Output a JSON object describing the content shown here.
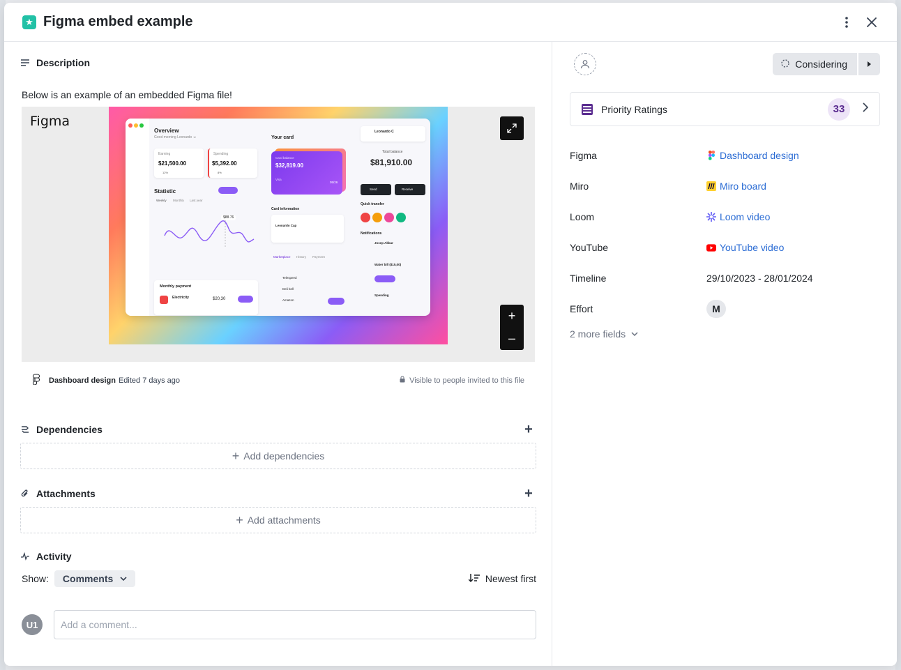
{
  "modal": {
    "title": "Figma embed example",
    "more_icon": "more-vertical-icon",
    "close_icon": "close-icon"
  },
  "description": {
    "heading": "Description",
    "text": "Below is an example of an embedded Figma file!"
  },
  "embed": {
    "brand": "Figma",
    "file_name": "Dashboard design",
    "edited": "Edited 7 days ago",
    "visibility": "Visible to people invited to this file",
    "zoom_in": "+",
    "zoom_out": "–",
    "preview": {
      "overview": "Overview",
      "good_morning": "Good morning Leonardo ☺",
      "earning_label": "Earning",
      "earning_value": "$21,500.00",
      "earning_pct": "12%",
      "spending_label": "Spending",
      "spending_value": "$5,392.00",
      "spending_pct": "8%",
      "statistic": "Statistic",
      "weekly": "Weekly",
      "monthly": "Monthly",
      "last_year": "Last year",
      "tooltip": "$88.76",
      "monthly_payment": "Monthly payment",
      "electricity": "Electricity",
      "electricity_value": "$20,30",
      "your_card": "Your card",
      "card_balance_label": "Card balance",
      "card_balance": "$32,819.00",
      "card_visa": "Visa",
      "card_exp": "05/26",
      "card_info": "Card information",
      "cardholder_name": "Leonardo Cap",
      "card_tab_marketplace": "Marketplace",
      "card_tab_history": "History",
      "card_tab_payment": "Payment",
      "market_items": [
        "Telespeed",
        "Deli bell",
        "Amazon"
      ],
      "user_name": "Leonardo C",
      "total_balance_label": "Total balance",
      "total_balance": "$81,910.00",
      "send": "Send",
      "receive": "Receive",
      "quick_transfer": "Quick transfer",
      "notifications": "Notifications",
      "notif_items": [
        "Josep Akbar",
        "Water bill ($15,00)",
        "Spending"
      ]
    }
  },
  "dependencies": {
    "heading": "Dependencies",
    "add_label": "Add dependencies"
  },
  "attachments": {
    "heading": "Attachments",
    "add_label": "Add attachments"
  },
  "activity": {
    "heading": "Activity",
    "show_label": "Show:",
    "show_value": "Comments",
    "sort_label": "Newest first",
    "avatar": "U1",
    "comment_placeholder": "Add a comment..."
  },
  "sidebar": {
    "status": "Considering",
    "priority_label": "Priority Ratings",
    "priority_score": "33",
    "fields": [
      {
        "name": "Figma",
        "value": "Dashboard design",
        "icon": "figma-icon",
        "link": true
      },
      {
        "name": "Miro",
        "value": "Miro board",
        "icon": "miro-icon",
        "link": true
      },
      {
        "name": "Loom",
        "value": "Loom video",
        "icon": "loom-icon",
        "link": true
      },
      {
        "name": "YouTube",
        "value": "YouTube video",
        "icon": "youtube-icon",
        "link": true
      },
      {
        "name": "Timeline",
        "value": "29/10/2023 - 28/01/2024",
        "link": false
      },
      {
        "name": "Effort",
        "value": "M",
        "link": false
      }
    ],
    "more_fields": "2 more fields"
  },
  "colors": {
    "accent_link": "#2b6cd4",
    "priority": "#5b2d90",
    "title_icon": "#22c1a6",
    "youtube": "#ff0000",
    "miro": "#ffd02f"
  }
}
